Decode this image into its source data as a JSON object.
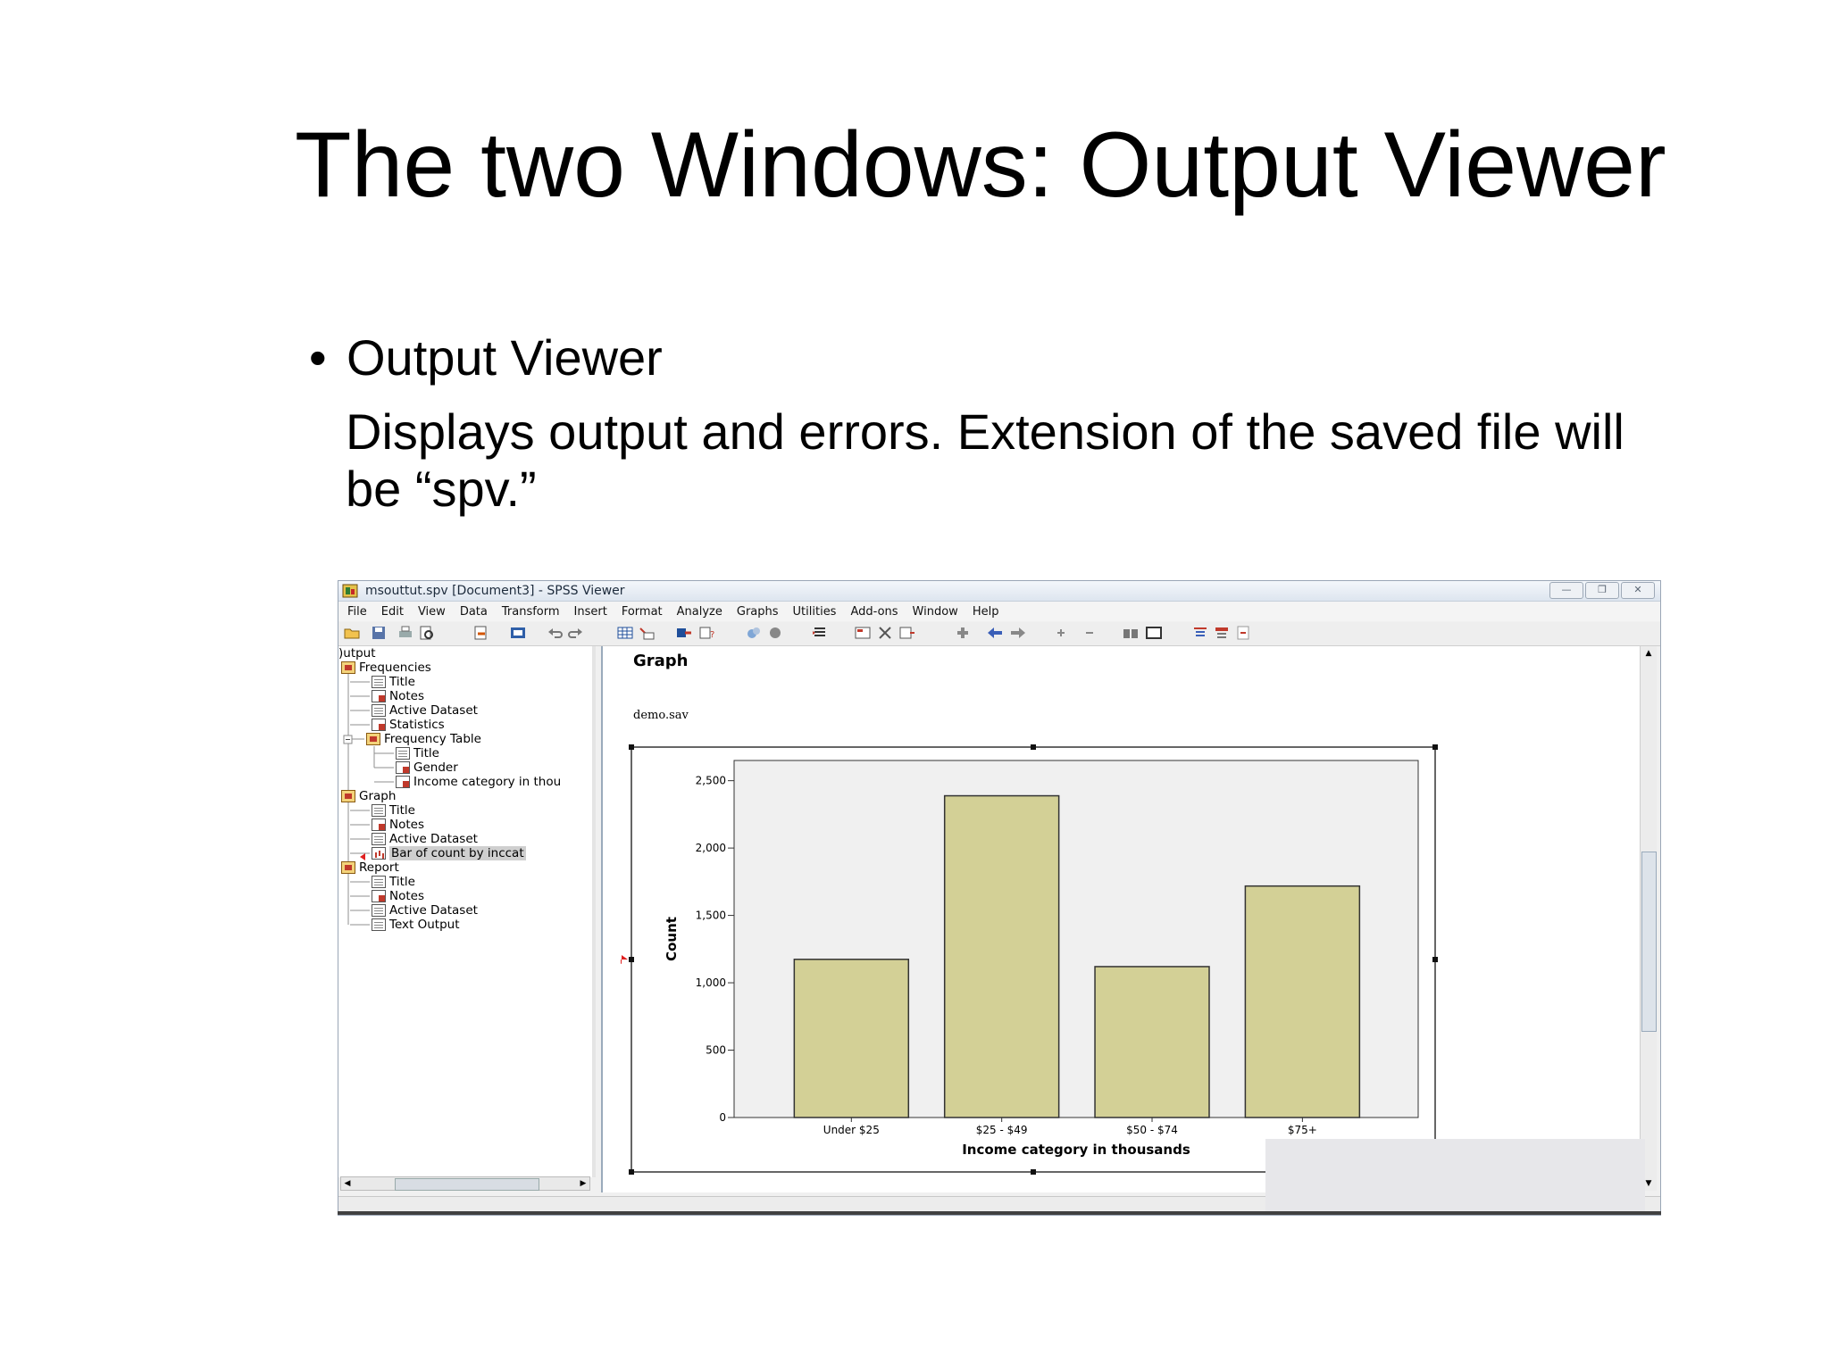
{
  "slide": {
    "title": "The two Windows: Output Viewer",
    "bullet": "Output Viewer",
    "body": "Displays output and errors. Extension of the saved file will be “spv.”"
  },
  "window": {
    "title": "msouttut.spv [Document3] - SPSS Viewer",
    "menu": [
      "File",
      "Edit",
      "View",
      "Data",
      "Transform",
      "Insert",
      "Format",
      "Analyze",
      "Graphs",
      "Utilities",
      "Add-ons",
      "Window",
      "Help"
    ]
  },
  "outline": {
    "root": ")utput",
    "frequencies": "Frequencies",
    "freq_title": "Title",
    "freq_notes": "Notes",
    "freq_active": "Active Dataset",
    "freq_stats": "Statistics",
    "freq_table": "Frequency Table",
    "ft_title": "Title",
    "ft_gender": "Gender",
    "ft_income": "Income category in thou",
    "graph": "Graph",
    "graph_title": "Title",
    "graph_notes": "Notes",
    "graph_active": "Active Dataset",
    "graph_bar": "Bar of count by inccat",
    "report": "Report",
    "report_title": "Title",
    "report_notes": "Notes",
    "report_active": "Active Dataset",
    "report_text": "Text Output"
  },
  "content": {
    "heading": "Graph",
    "dataset": "demo.sav"
  },
  "chart_data": {
    "type": "bar",
    "categories": [
      "Under $25",
      "$25 - $49",
      "$50 - $74",
      "$75+"
    ],
    "values": [
      1174,
      2388,
      1120,
      1718
    ],
    "xlabel": "Income category in thousands",
    "ylabel": "Count",
    "ylim": [
      0,
      2650
    ],
    "yticks": [
      0,
      500,
      1000,
      1500,
      2000,
      2500
    ],
    "ytick_labels": [
      "0",
      "500",
      "1,000",
      "1,500",
      "2,000",
      "2,500"
    ],
    "bar_color": "#d3d096",
    "plot_bg": "#f0f0f0"
  }
}
